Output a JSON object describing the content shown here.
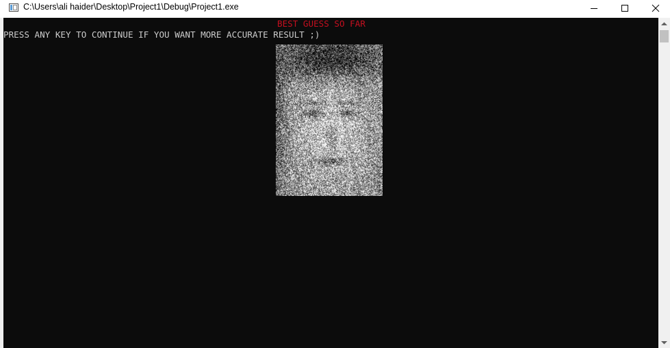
{
  "window": {
    "title": "C:\\Users\\ali haider\\Desktop\\Project1\\Debug\\Project1.exe",
    "controls": [
      "minimize-icon",
      "maximize-icon",
      "close-icon"
    ]
  },
  "console": {
    "best_guess": "BEST GUESS SO FAR",
    "prompt": "PRESS ANY KEY TO CONTINUE IF YOU WANT MORE ACCURATE RESULT ;)",
    "background": "#0c0c0c",
    "text_color": "#cccccc",
    "accent_color": "#c50f1f"
  }
}
